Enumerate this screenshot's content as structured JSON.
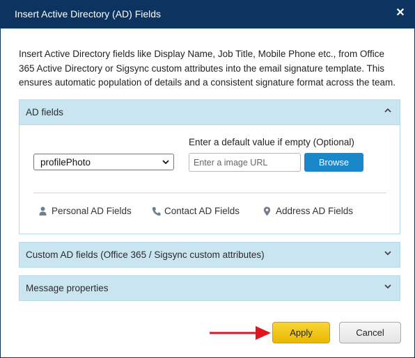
{
  "dialog": {
    "title": "Insert Active Directory (AD) Fields",
    "close_label": "✕",
    "intro": "Insert Active Directory fields like Display Name, Job Title, Mobile Phone etc., from Office 365 Active Directory or Sigsync custom attributes into the email signature template. This ensures automatic population of details and a consistent signature format across the team."
  },
  "ad_fields": {
    "header": "AD fields",
    "expanded": true,
    "selected_field": "profilePhoto",
    "default_label": "Enter a default value if empty (Optional)",
    "url_placeholder": "Enter a image URL",
    "url_value": "",
    "browse_label": "Browse",
    "links": [
      {
        "label": "Personal AD Fields",
        "icon": "person-icon"
      },
      {
        "label": "Contact AD Fields",
        "icon": "phone-icon"
      },
      {
        "label": "Address AD Fields",
        "icon": "map-pin-icon"
      }
    ]
  },
  "custom_fields": {
    "header": "Custom AD fields (Office 365 / Sigsync custom attributes)",
    "expanded": false
  },
  "message_properties": {
    "header": "Message properties",
    "expanded": false
  },
  "footer": {
    "apply_label": "Apply",
    "cancel_label": "Cancel"
  },
  "colors": {
    "title_bar": "#0d3461",
    "panel_header": "#c9e5f2",
    "browse_button": "#1a87c9",
    "apply_button": "#f2c40f",
    "annotation_arrow": "#e0141c"
  }
}
